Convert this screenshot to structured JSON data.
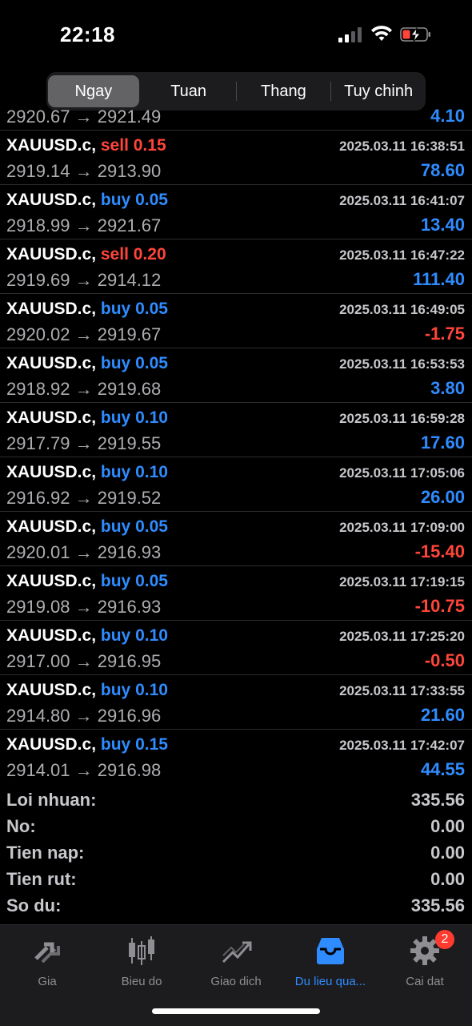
{
  "status_bar": {
    "time": "22:18"
  },
  "period_tabs": [
    {
      "label": "Ngay",
      "active": true
    },
    {
      "label": "Tuan",
      "active": false
    },
    {
      "label": "Thang",
      "active": false
    },
    {
      "label": "Tuy chinh",
      "active": false
    }
  ],
  "partial_row": {
    "price": "2920.67 → 2921.49",
    "profit": "4.10"
  },
  "trades": [
    {
      "symbol": "XAUUSD.c,",
      "side": "sell",
      "volume": "0.15",
      "datetime": "2025.03.11 16:38:51",
      "price": "2919.14 → 2913.90",
      "profit": "78.60"
    },
    {
      "symbol": "XAUUSD.c,",
      "side": "buy",
      "volume": "0.05",
      "datetime": "2025.03.11 16:41:07",
      "price": "2918.99 → 2921.67",
      "profit": "13.40"
    },
    {
      "symbol": "XAUUSD.c,",
      "side": "sell",
      "volume": "0.20",
      "datetime": "2025.03.11 16:47:22",
      "price": "2919.69 → 2914.12",
      "profit": "111.40"
    },
    {
      "symbol": "XAUUSD.c,",
      "side": "buy",
      "volume": "0.05",
      "datetime": "2025.03.11 16:49:05",
      "price": "2920.02 → 2919.67",
      "profit": "-1.75"
    },
    {
      "symbol": "XAUUSD.c,",
      "side": "buy",
      "volume": "0.05",
      "datetime": "2025.03.11 16:53:53",
      "price": "2918.92 → 2919.68",
      "profit": "3.80"
    },
    {
      "symbol": "XAUUSD.c,",
      "side": "buy",
      "volume": "0.10",
      "datetime": "2025.03.11 16:59:28",
      "price": "2917.79 → 2919.55",
      "profit": "17.60"
    },
    {
      "symbol": "XAUUSD.c,",
      "side": "buy",
      "volume": "0.10",
      "datetime": "2025.03.11 17:05:06",
      "price": "2916.92 → 2919.52",
      "profit": "26.00"
    },
    {
      "symbol": "XAUUSD.c,",
      "side": "buy",
      "volume": "0.05",
      "datetime": "2025.03.11 17:09:00",
      "price": "2920.01 → 2916.93",
      "profit": "-15.40"
    },
    {
      "symbol": "XAUUSD.c,",
      "side": "buy",
      "volume": "0.05",
      "datetime": "2025.03.11 17:19:15",
      "price": "2919.08 → 2916.93",
      "profit": "-10.75"
    },
    {
      "symbol": "XAUUSD.c,",
      "side": "buy",
      "volume": "0.10",
      "datetime": "2025.03.11 17:25:20",
      "price": "2917.00 → 2916.95",
      "profit": "-0.50"
    },
    {
      "symbol": "XAUUSD.c,",
      "side": "buy",
      "volume": "0.10",
      "datetime": "2025.03.11 17:33:55",
      "price": "2914.80 → 2916.96",
      "profit": "21.60"
    },
    {
      "symbol": "XAUUSD.c,",
      "side": "buy",
      "volume": "0.15",
      "datetime": "2025.03.11 17:42:07",
      "price": "2914.01 → 2916.98",
      "profit": "44.55"
    }
  ],
  "summary": [
    {
      "label": "Loi nhuan:",
      "value": "335.56"
    },
    {
      "label": "No:",
      "value": "0.00"
    },
    {
      "label": "Tien nap:",
      "value": "0.00"
    },
    {
      "label": "Tien rut:",
      "value": "0.00"
    },
    {
      "label": "So du:",
      "value": "335.56"
    }
  ],
  "tab_bar": [
    {
      "label": "Gia",
      "icon": "quotes-arrows-icon",
      "active": false
    },
    {
      "label": "Bieu do",
      "icon": "candlestick-chart-icon",
      "active": false
    },
    {
      "label": "Giao dich",
      "icon": "trade-trend-icon",
      "active": false
    },
    {
      "label": "Du lieu qua...",
      "icon": "history-inbox-icon",
      "active": true
    },
    {
      "label": "Cai dat",
      "icon": "gear-icon",
      "active": false,
      "badge": "2"
    }
  ],
  "colors": {
    "buy": "#2f8cff",
    "sell": "#ff453a",
    "accent": "#2f8cff",
    "badge": "#ff3b30"
  }
}
